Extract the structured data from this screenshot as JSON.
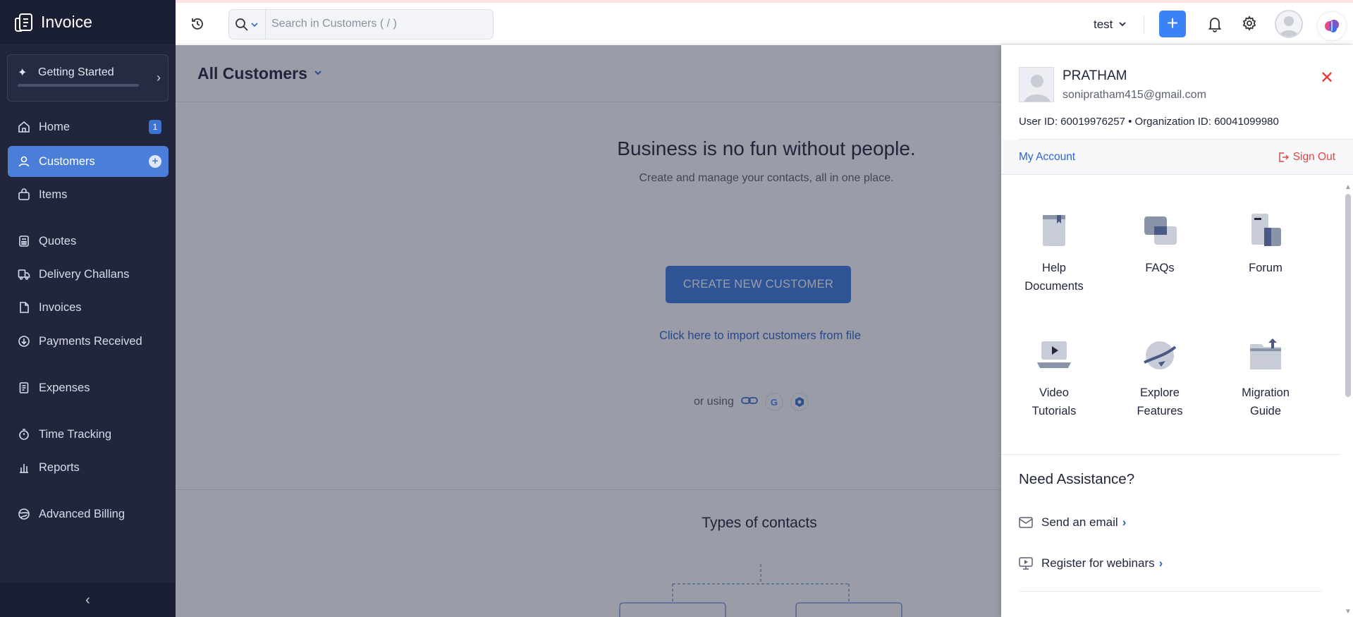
{
  "app": {
    "name": "Invoice"
  },
  "sidebar": {
    "getting_started": "Getting Started",
    "items": [
      {
        "label": "Home",
        "icon": "home-icon",
        "badge": "1"
      },
      {
        "label": "Customers",
        "icon": "user-icon",
        "active": true
      },
      {
        "label": "Items",
        "icon": "bag-icon"
      },
      {
        "label": "Quotes",
        "icon": "calculator-icon"
      },
      {
        "label": "Delivery Challans",
        "icon": "truck-icon"
      },
      {
        "label": "Invoices",
        "icon": "document-icon"
      },
      {
        "label": "Payments Received",
        "icon": "download-circle-icon"
      },
      {
        "label": "Expenses",
        "icon": "receipt-icon"
      },
      {
        "label": "Time Tracking",
        "icon": "stopwatch-icon"
      },
      {
        "label": "Reports",
        "icon": "bar-chart-icon"
      },
      {
        "label": "Advanced Billing",
        "icon": "globe-icon"
      }
    ]
  },
  "topbar": {
    "search_placeholder": "Search in Customers ( / )",
    "org_name": "test"
  },
  "main": {
    "title": "All Customers",
    "headline": "Business is no fun without people.",
    "subtext": "Create and manage your contacts, all in one place.",
    "cta": "CREATE NEW CUSTOMER",
    "import_link": "Click here to import customers from file",
    "or_using": "or using",
    "types_title": "Types of contacts"
  },
  "profile": {
    "name": "PRATHAM",
    "email": "sonipratham415@gmail.com",
    "ids": "User ID: 60019976257 • Organization ID: 60041099980",
    "my_account": "My Account",
    "sign_out": "Sign Out",
    "tiles": [
      {
        "line1": "Help",
        "line2": "Documents",
        "icon": "help-documents-icon"
      },
      {
        "line1": "FAQs",
        "line2": "",
        "icon": "faq-chat-icon"
      },
      {
        "line1": "Forum",
        "line2": "",
        "icon": "forum-icon"
      },
      {
        "line1": "Video",
        "line2": "Tutorials",
        "icon": "video-tutorials-icon"
      },
      {
        "line1": "Explore",
        "line2": "Features",
        "icon": "explore-features-icon"
      },
      {
        "line1": "Migration",
        "line2": "Guide",
        "icon": "migration-guide-icon"
      }
    ],
    "need_assistance": "Need Assistance?",
    "send_email": "Send an email",
    "register_webinars": "Register for webinars"
  },
  "colors": {
    "sidebar_bg": "#21263c",
    "accent": "#3b82f6",
    "active_nav": "#4a7ed8",
    "link": "#2f64c9",
    "danger": "#e53935"
  }
}
